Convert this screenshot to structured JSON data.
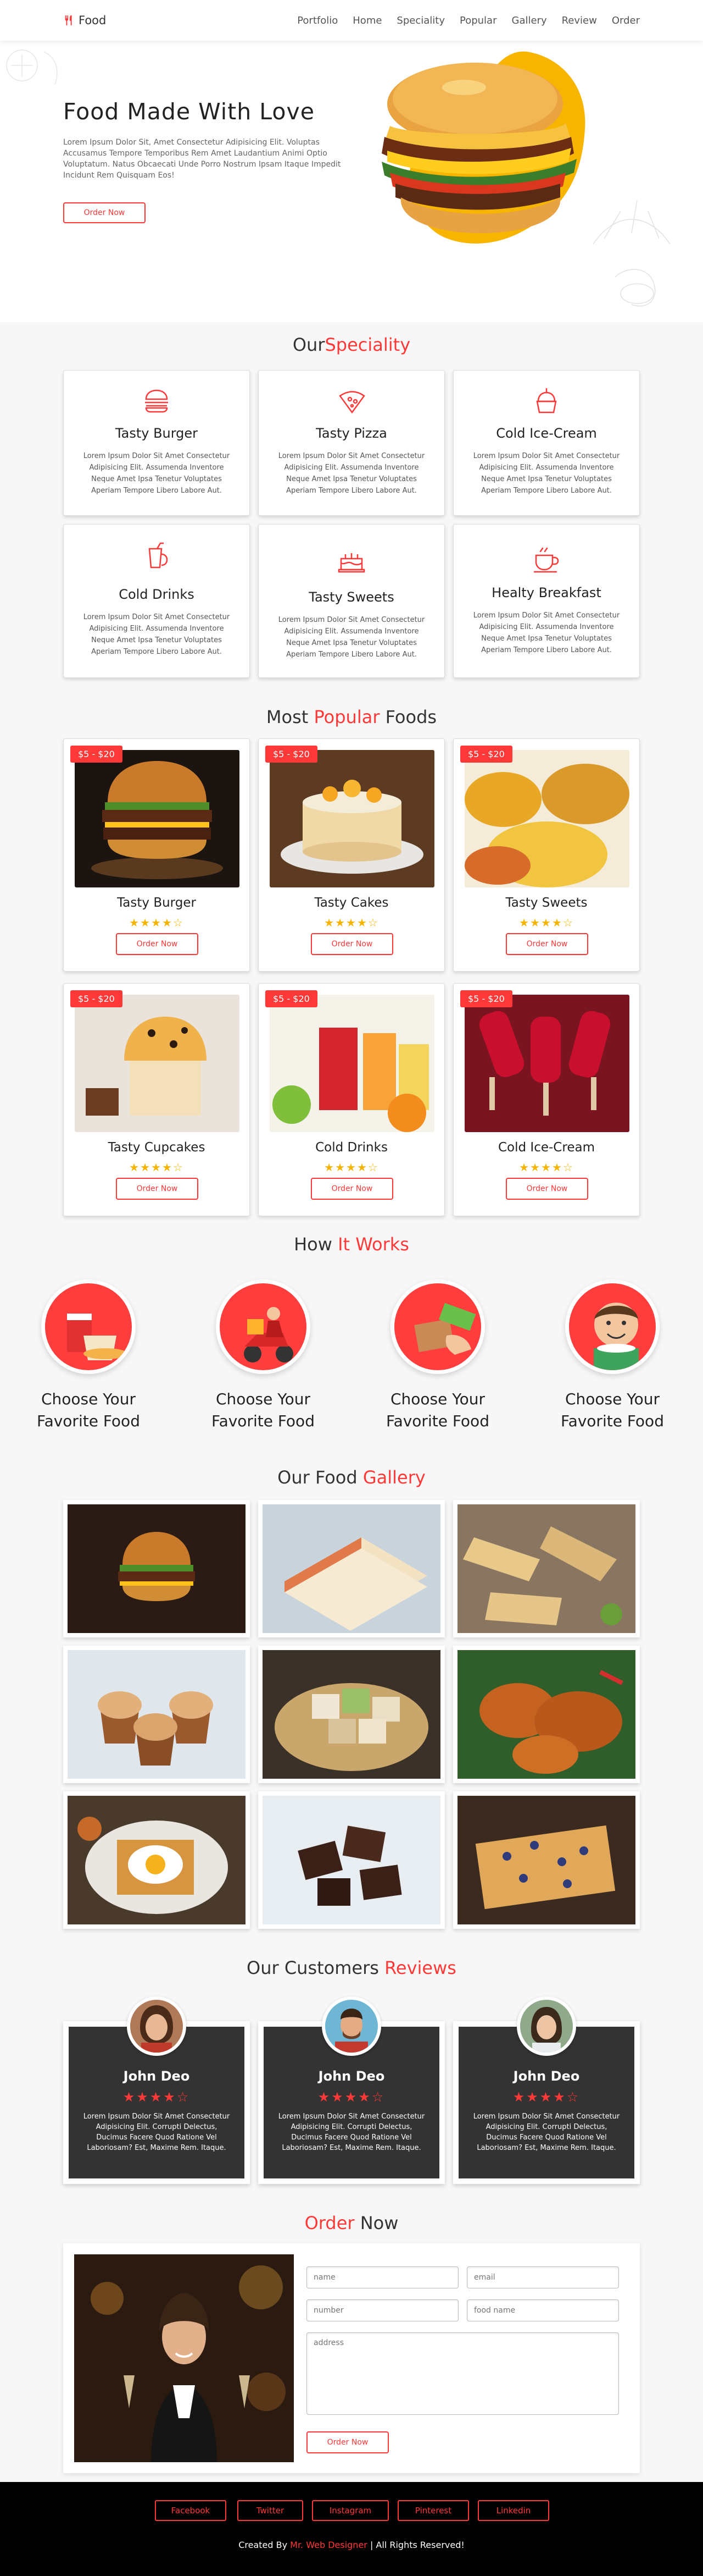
{
  "nav": {
    "logo": "Food",
    "links": [
      "Portfolio",
      "Home",
      "Speciality",
      "Popular",
      "Gallery",
      "Review",
      "Order"
    ]
  },
  "home": {
    "title": "Food Made With Love",
    "text": "Lorem Ipsum Dolor Sit, Amet Consectetur Adipisicing Elit. Voluptas Accusamus Tempore Temporibus Rem Amet Laudantium Animi Optio Voluptatum. Natus Obcaecati Unde Porro Nostrum Ipsam Itaque Impedit Incidunt Rem Quisquam Eos!",
    "button": "Order Now"
  },
  "speciality": {
    "title_a": "Our",
    "title_b": "Speciality",
    "items": [
      {
        "name": "Tasty Burger",
        "icon": "burger-icon",
        "text": "Lorem Ipsum Dolor Sit Amet Consectetur Adipisicing Elit. Assumenda Inventore Neque Amet Ipsa Tenetur Voluptates Aperiam Tempore Libero Labore Aut."
      },
      {
        "name": "Tasty Pizza",
        "icon": "pizza-icon",
        "text": "Lorem Ipsum Dolor Sit Amet Consectetur Adipisicing Elit. Assumenda Inventore Neque Amet Ipsa Tenetur Voluptates Aperiam Tempore Libero Labore Aut."
      },
      {
        "name": "Cold Ice-Cream",
        "icon": "ice-cream-icon",
        "text": "Lorem Ipsum Dolor Sit Amet Consectetur Adipisicing Elit. Assumenda Inventore Neque Amet Ipsa Tenetur Voluptates Aperiam Tempore Libero Labore Aut."
      },
      {
        "name": "Cold Drinks",
        "icon": "drink-icon",
        "text": "Lorem Ipsum Dolor Sit Amet Consectetur Adipisicing Elit. Assumenda Inventore Neque Amet Ipsa Tenetur Voluptates Aperiam Tempore Libero Labore Aut."
      },
      {
        "name": "Tasty Sweets",
        "icon": "cake-icon",
        "text": "Lorem Ipsum Dolor Sit Amet Consectetur Adipisicing Elit. Assumenda Inventore Neque Amet Ipsa Tenetur Voluptates Aperiam Tempore Libero Labore Aut."
      },
      {
        "name": "Healty Breakfast",
        "icon": "coffee-icon",
        "text": "Lorem Ipsum Dolor Sit Amet Consectetur Adipisicing Elit. Assumenda Inventore Neque Amet Ipsa Tenetur Voluptates Aperiam Tempore Libero Labore Aut."
      }
    ]
  },
  "popular": {
    "title_a": "Most",
    "title_b": "Popular",
    "title_c": "Foods",
    "items": [
      {
        "name": "Tasty Burger",
        "price": "$5 - $20",
        "stars": "★★★★☆",
        "button": "Order Now"
      },
      {
        "name": "Tasty Cakes",
        "price": "$5 - $20",
        "stars": "★★★★☆",
        "button": "Order Now"
      },
      {
        "name": "Tasty Sweets",
        "price": "$5 - $20",
        "stars": "★★★★☆",
        "button": "Order Now"
      },
      {
        "name": "Tasty Cupcakes",
        "price": "$5 - $20",
        "stars": "★★★★☆",
        "button": "Order Now"
      },
      {
        "name": "Cold Drinks",
        "price": "$5 - $20",
        "stars": "★★★★☆",
        "button": "Order Now"
      },
      {
        "name": "Cold Ice-Cream",
        "price": "$5 - $20",
        "stars": "★★★★☆",
        "button": "Order Now"
      }
    ]
  },
  "steps": {
    "title_a": "How",
    "title_b": "It Works",
    "items": [
      {
        "line1": "Choose Your",
        "line2": "Favorite Food"
      },
      {
        "line1": "Choose Your",
        "line2": "Favorite Food"
      },
      {
        "line1": "Choose Your",
        "line2": "Favorite Food"
      },
      {
        "line1": "Choose Your",
        "line2": "Favorite Food"
      }
    ]
  },
  "gallery": {
    "title_a": "Our Food",
    "title_b": "Gallery"
  },
  "review": {
    "title_a": "Our Customers",
    "title_b": "Reviews",
    "items": [
      {
        "name": "John Deo",
        "stars": "★★★★☆",
        "text": "Lorem Ipsum Dolor Sit Amet Consectetur Adipisicing Elit. Corrupti Delectus, Ducimus Facere Quod Ratione Vel Laboriosam? Est, Maxime Rem. Itaque."
      },
      {
        "name": "John Deo",
        "stars": "★★★★☆",
        "text": "Lorem Ipsum Dolor Sit Amet Consectetur Adipisicing Elit. Corrupti Delectus, Ducimus Facere Quod Ratione Vel Laboriosam? Est, Maxime Rem. Itaque."
      },
      {
        "name": "John Deo",
        "stars": "★★★★☆",
        "text": "Lorem Ipsum Dolor Sit Amet Consectetur Adipisicing Elit. Corrupti Delectus, Ducimus Facere Quod Ratione Vel Laboriosam? Est, Maxime Rem. Itaque."
      }
    ]
  },
  "order": {
    "title_a": "Order",
    "title_b": "Now",
    "placeholders": {
      "name": "name",
      "email": "email",
      "number": "number",
      "food": "food name",
      "address": "address"
    },
    "button": "Order Now"
  },
  "footer": {
    "links": [
      "Facebook",
      "Twitter",
      "Instagram",
      "Pinterest",
      "Linkedin"
    ],
    "credit_a": "Created By",
    "credit_b": "Mr. Web Designer",
    "credit_c": "| All Rights Reserved!"
  },
  "colors": {
    "accent": "#ff3838",
    "dark": "#333333"
  }
}
